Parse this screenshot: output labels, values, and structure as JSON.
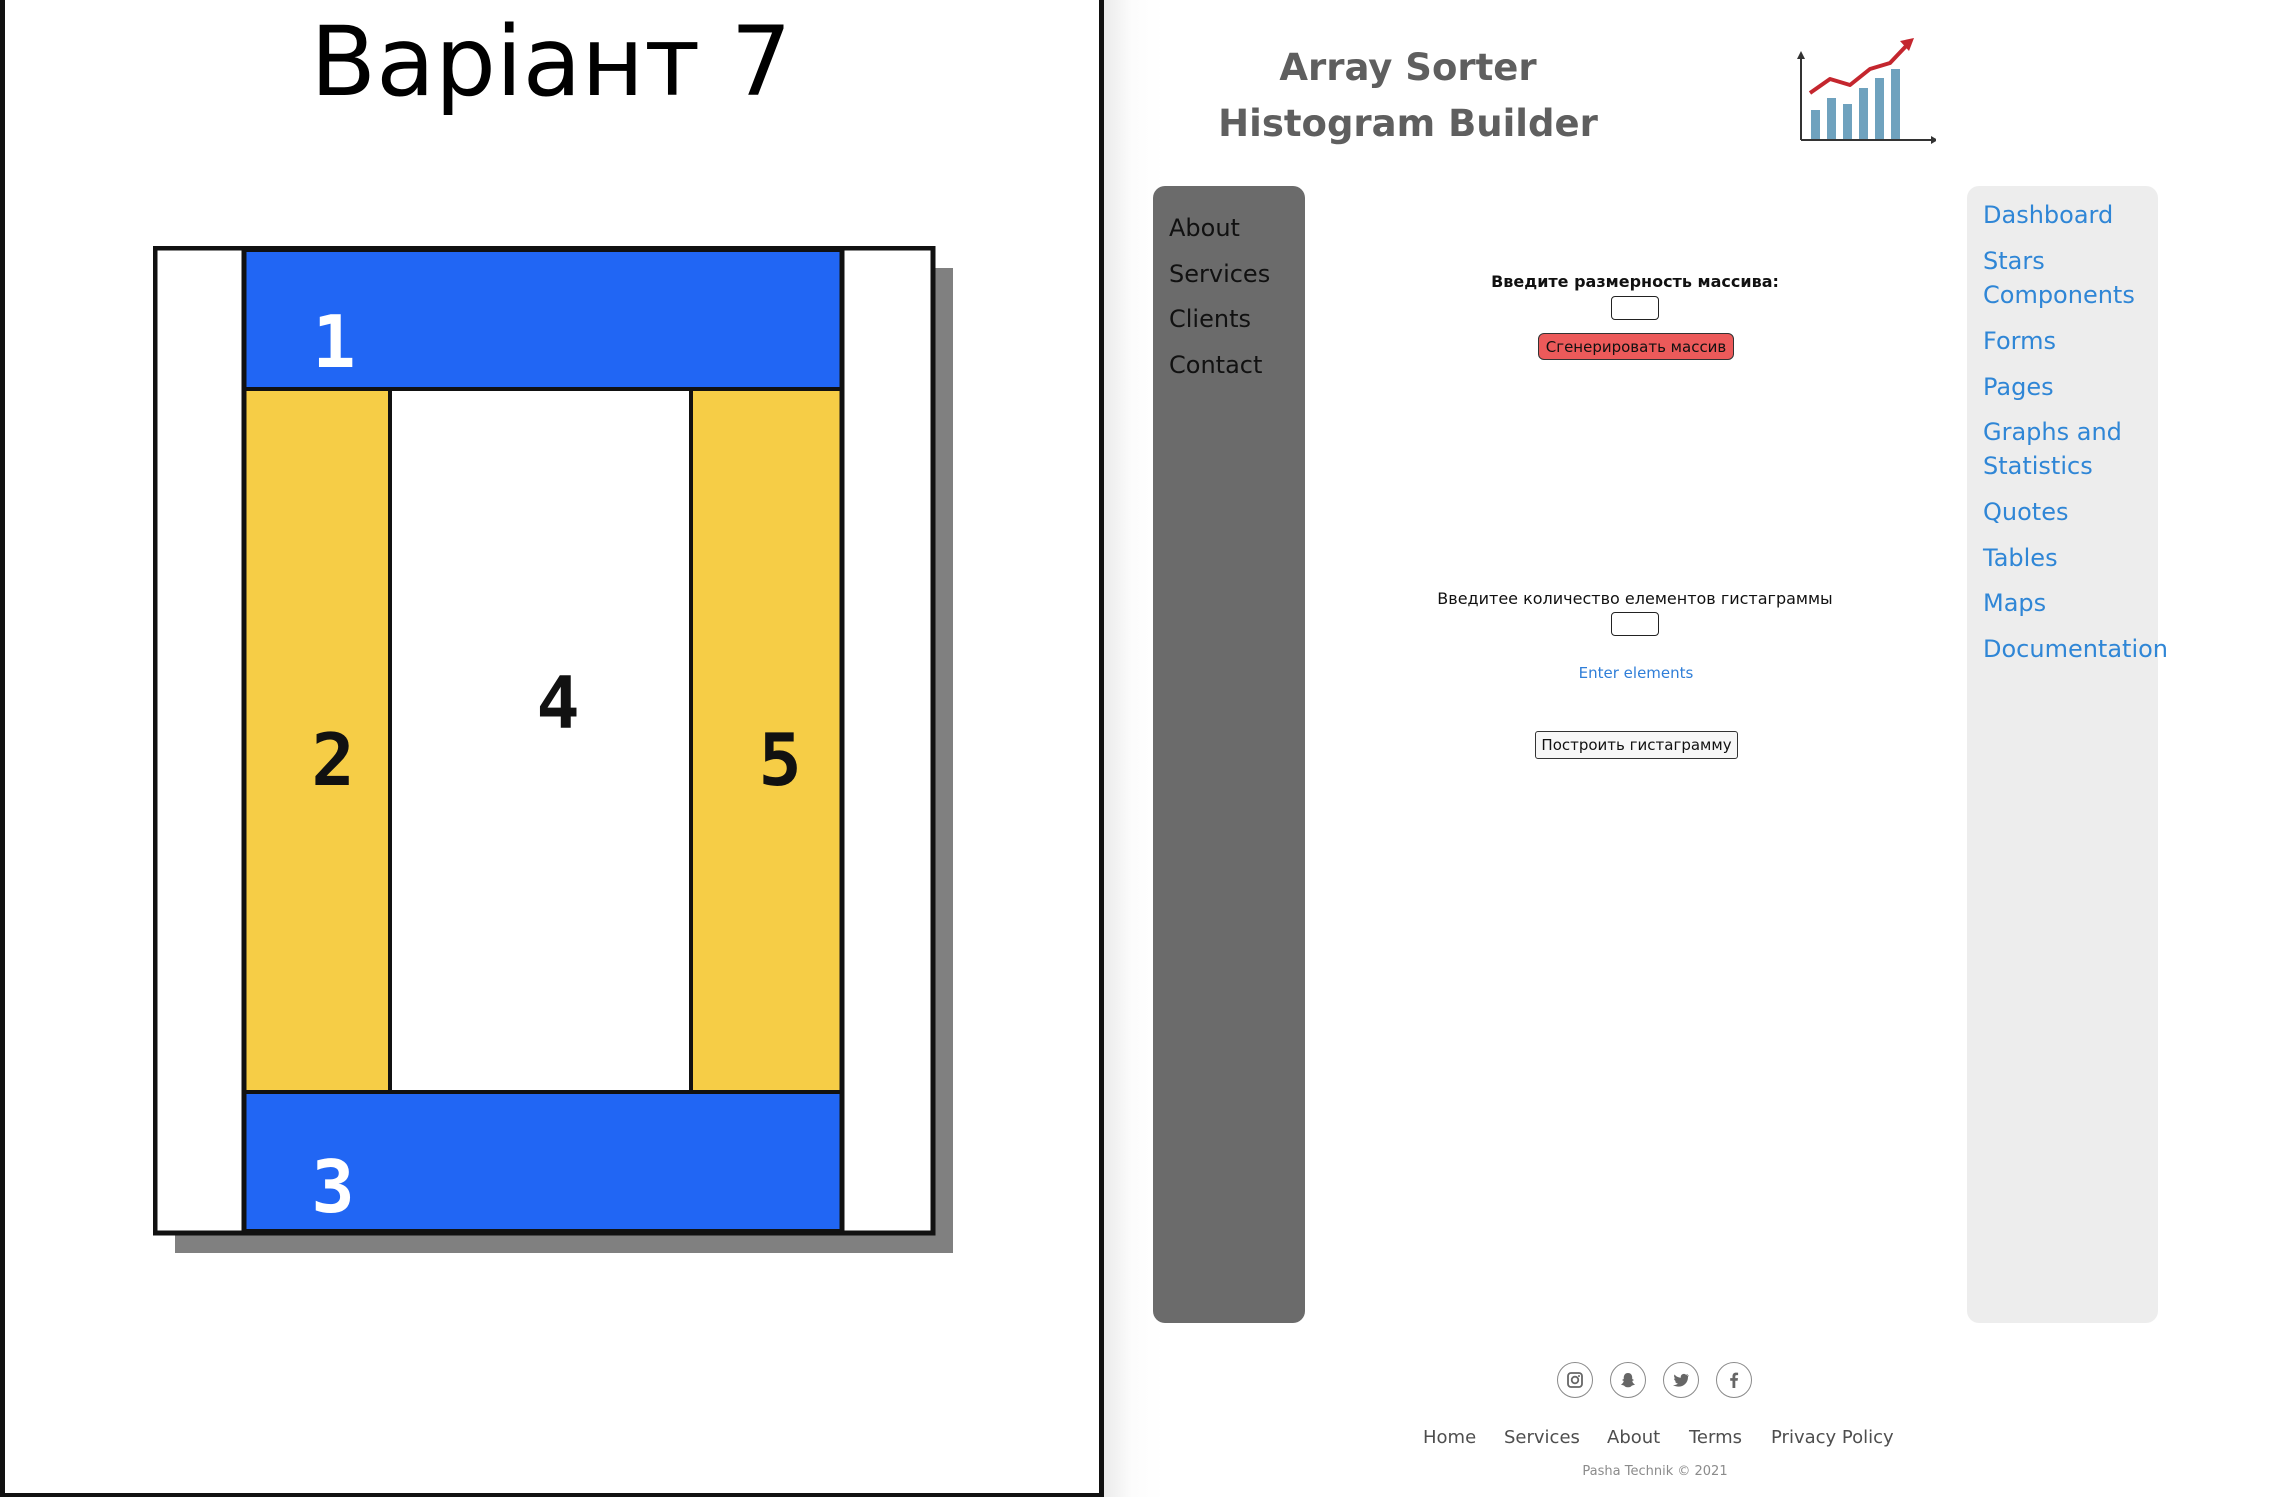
{
  "variant": {
    "title": "Варіант 7"
  },
  "layout_diagram": {
    "blocks": [
      {
        "number": "1",
        "color": "#2166f4"
      },
      {
        "number": "2",
        "color": "#f6cd46"
      },
      {
        "number": "3",
        "color": "#2166f4"
      },
      {
        "number": "4",
        "color": "#ffffff"
      },
      {
        "number": "5",
        "color": "#f6cd46"
      }
    ]
  },
  "app": {
    "title_line1": "Array Sorter",
    "title_line2": "Histogram Builder",
    "logo_icon": "chart-growth-icon"
  },
  "left_nav": {
    "items": [
      "About",
      "Services",
      "Clients",
      "Contact"
    ]
  },
  "right_nav": {
    "items": [
      "Dashboard",
      "Stars Components",
      "Forms",
      "Pages",
      "Graphs and Statistics",
      "Quotes",
      "Tables",
      "Maps",
      "Documentation"
    ]
  },
  "main": {
    "size_label": "Введите размерность массива:",
    "size_value": "",
    "generate_label": "Сгенерировать массив",
    "count_label": "Введитее количество елементов гистаграммы",
    "count_value": "",
    "enter_link": "Enter elements",
    "build_label": "Построить гистаграмму"
  },
  "footer": {
    "social_icons": [
      "instagram-icon",
      "snapchat-icon",
      "twitter-icon",
      "facebook-icon"
    ],
    "links": [
      "Home",
      "Services",
      "About",
      "Terms",
      "Privacy Policy"
    ],
    "copyright": "Pasha Technik © 2021"
  },
  "colors": {
    "accent_link": "#2f86d6",
    "button_red": "#ec5a5a",
    "sidebar_dark": "#6b6b6b",
    "sidebar_light": "#ededed"
  }
}
